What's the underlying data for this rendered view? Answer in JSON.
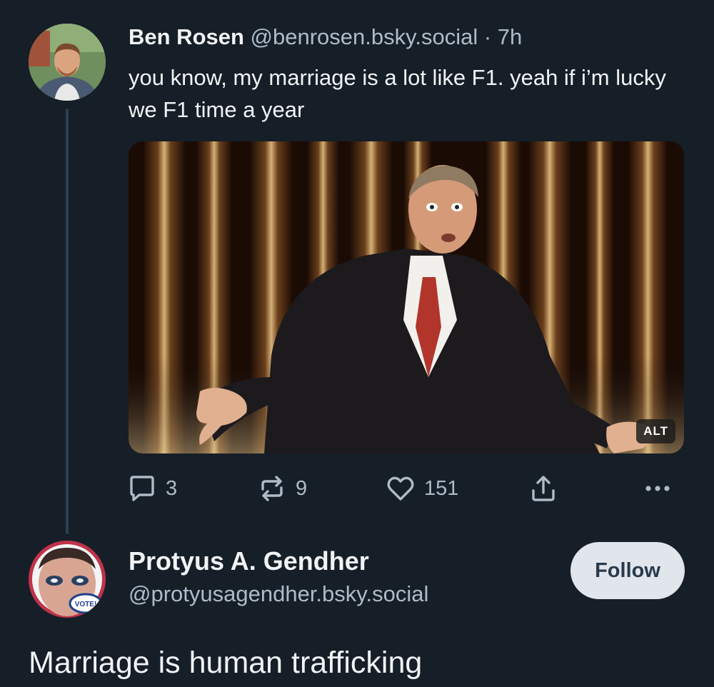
{
  "post": {
    "author_name": "Ben Rosen",
    "author_handle": "@benrosen.bsky.social",
    "separator": "·",
    "time": "7h",
    "text": "you know, my marriage is a lot like F1. yeah if i’m lucky we F1 time a year",
    "media": {
      "alt_badge": "ALT"
    },
    "actions": {
      "reply_icon": "speech-bubble-icon",
      "reply_count": "3",
      "repost_icon": "repost-arrows-icon",
      "repost_count": "9",
      "like_icon": "heart-icon",
      "like_count": "151",
      "share_icon": "share-upload-icon",
      "more_icon": "ellipsis-icon"
    }
  },
  "reply": {
    "author_name": "Protyus A. Gendher",
    "author_handle": "@protyusagendher.bsky.social",
    "follow_label": "Follow",
    "text": "Marriage is human trafficking",
    "avatar_badge_text": "VOTE!"
  },
  "colors": {
    "background": "#161e27",
    "text_primary": "#f1f3f5",
    "text_secondary": "#aebbc9",
    "thread_line": "#2e4052",
    "follow_bg": "#e1e6ec",
    "follow_text": "#2a3a4c"
  }
}
